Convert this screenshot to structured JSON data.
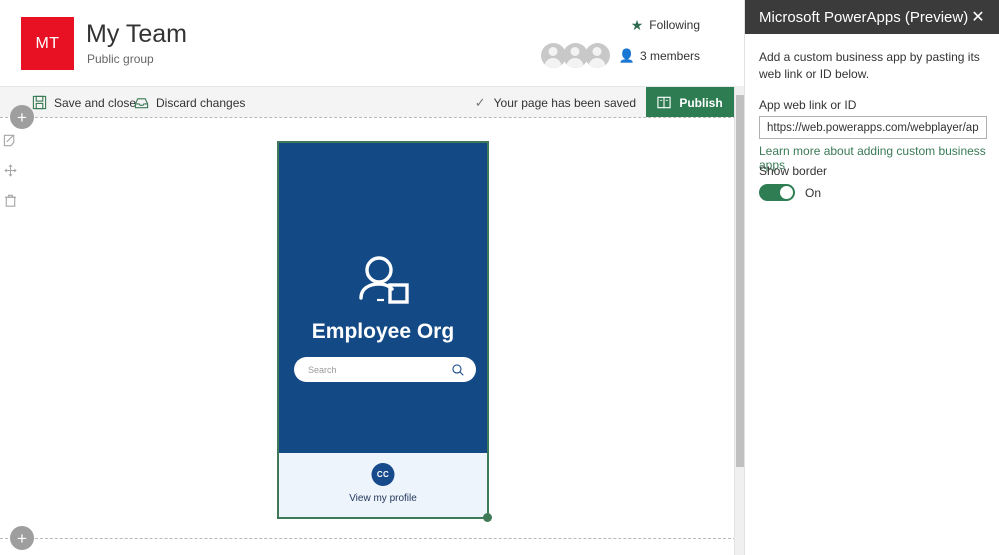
{
  "site": {
    "logo_initials": "MT",
    "logo_color": "#e81123",
    "title": "My Team",
    "subtitle": "Public group",
    "following_label": "Following",
    "following_icon": "star-icon",
    "members_label": "3 members",
    "members_icon": "person-icon"
  },
  "command_bar": {
    "save_label": "Save and close",
    "save_icon": "save-icon",
    "discard_label": "Discard changes",
    "discard_icon": "discard-icon",
    "status_label": "Your page has been saved",
    "status_icon": "checkmark-icon",
    "publish_label": "Publish",
    "publish_icon": "book-icon",
    "publish_color": "#2e7d52"
  },
  "canvas": {
    "add_section_top_label": "+",
    "add_section_bottom_label": "+",
    "tools": [
      {
        "name": "edit-webpart-icon",
        "label": "Edit web part"
      },
      {
        "name": "move-webpart-icon",
        "label": "Move web part"
      },
      {
        "name": "delete-webpart-icon",
        "label": "Delete web part"
      }
    ],
    "selection_color": "#3f7a58"
  },
  "webpart": {
    "background_color": "#134a86",
    "avatar_icon": "person-org-icon",
    "title": "Employee Org",
    "search_placeholder": "Search",
    "search_icon": "search-icon",
    "profile_initials": "CC",
    "profile_link_label": "View my profile",
    "footer_color": "#eef4fb"
  },
  "panel": {
    "title": "Microsoft PowerApps (Preview)",
    "close_icon": "close-icon",
    "description": "Add a custom business app by pasting its web link or ID below.",
    "field_label": "App web link or ID",
    "field_value": "https://web.powerapps.com/webplayer/ap...",
    "field_placeholder": "App web link or ID",
    "learn_more_label": "Learn more about adding custom business apps",
    "toggle_label": "Show border",
    "toggle_state": "On",
    "toggle_on_color": "#2f7d52"
  }
}
